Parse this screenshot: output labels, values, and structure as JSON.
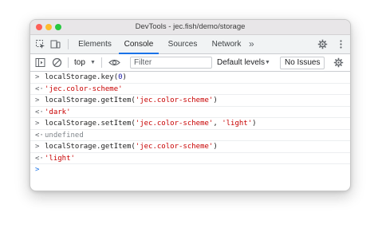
{
  "window": {
    "title": "DevTools - jec.fish/demo/storage"
  },
  "tabs": [
    {
      "label": "Elements"
    },
    {
      "label": "Console"
    },
    {
      "label": "Sources"
    },
    {
      "label": "Network"
    }
  ],
  "more_tabs": "»",
  "toolbar": {
    "context": "top",
    "filter_placeholder": "Filter",
    "levels": "Default levels",
    "issues": "No Issues"
  },
  "console": {
    "lines": [
      {
        "type": "input",
        "prefix": "localStorage.key(",
        "num": "0",
        "suffix": ")"
      },
      {
        "type": "output",
        "value": "'jec.color-scheme'"
      },
      {
        "type": "input",
        "prefix": "localStorage.getItem(",
        "str": "'jec.color-scheme'",
        "suffix": ")"
      },
      {
        "type": "output",
        "value": "'dark'"
      },
      {
        "type": "input",
        "prefix": "localStorage.setItem(",
        "str": "'jec.color-scheme'",
        "sep": ", ",
        "str2": "'light'",
        "suffix": ")"
      },
      {
        "type": "output",
        "value": "undefined"
      },
      {
        "type": "input",
        "prefix": "localStorage.getItem(",
        "str": "'jec.color-scheme'",
        "suffix": ")"
      },
      {
        "type": "output",
        "value": "'light'"
      }
    ]
  },
  "colors": {
    "accent": "#1a73e8",
    "string": "#c80000",
    "number": "#1a1aa6",
    "undefined": "#80868b"
  },
  "icons": {
    "input_prompt": "chevron-right-icon",
    "output_prompt": "return-arrow-icon"
  }
}
